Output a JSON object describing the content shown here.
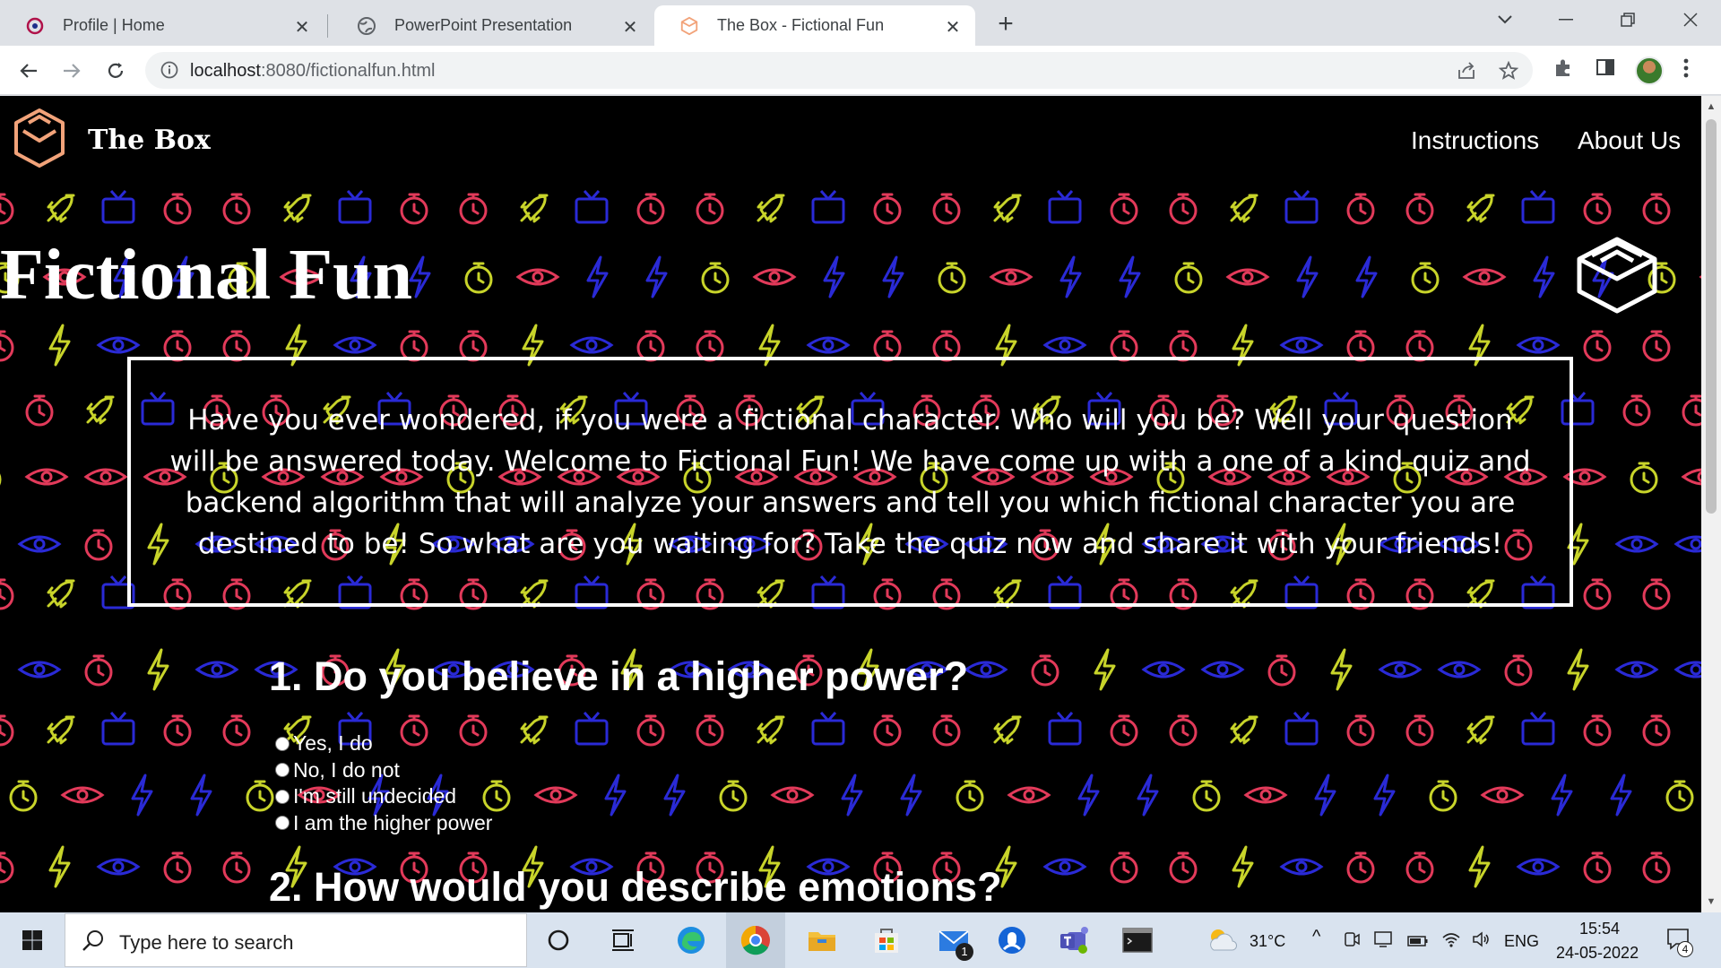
{
  "browser": {
    "tabs": [
      {
        "title": "Profile | Home",
        "favicon": "profile-app-icon"
      },
      {
        "title": "PowerPoint Presentation",
        "favicon": "globe-icon"
      },
      {
        "title": "The Box - Fictional Fun",
        "favicon": "box-logo-icon",
        "active": true
      }
    ],
    "url_host": "localhost",
    "url_rest": ":8080/fictionalfun.html"
  },
  "site": {
    "brand": "The Box",
    "nav": [
      "Instructions",
      "About Us"
    ],
    "title": "Fictional Fun",
    "intro": "Have you ever wondered, if you were a fictional character. Who will you be? Well your question will be answered today. Welcome to Fictional Fun! We have come up with a one of a kind quiz and backend algorithm that will analyze your answers and tell you which fictional character you are destined to be! So what are you waiting for? Take the quiz now and share it with your friends!",
    "questions": [
      {
        "text": "1. Do you believe in a higher power?",
        "options": [
          "Yes, I do",
          "No, I do not",
          "I'm still undecided",
          "I am the higher power"
        ]
      },
      {
        "text": "2. How would you describe emotions?"
      }
    ],
    "pattern_icons": [
      "rocket-icon",
      "tv-icon",
      "stopwatch-icon",
      "eye-icon",
      "lightning-icon"
    ],
    "colors": {
      "yellow": "#c8d42a",
      "blue": "#2a2ad6",
      "red": "#e23a5a",
      "logo": "#f2a37a"
    }
  },
  "taskbar": {
    "search_placeholder": "Type here to search",
    "weather": "31°C",
    "language": "ENG",
    "time": "15:54",
    "date": "24-05-2022",
    "mail_badge": "1",
    "notification_count": "4"
  }
}
